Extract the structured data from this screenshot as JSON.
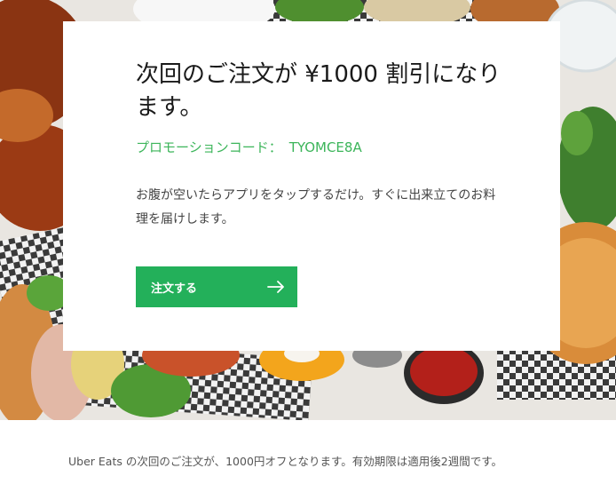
{
  "hero": {
    "title": "次回のご注文が ¥1000 割引になります。",
    "promo_label": "プロモーションコード：",
    "promo_code": "TYOMCE8A",
    "description": "お腹が空いたらアプリをタップするだけ。すぐに出来立てのお料理を届けします。",
    "cta_label": "注文する",
    "cta_icon": "arrow-right-icon"
  },
  "footer": {
    "text": "Uber Eats の次回のご注文が、1000円オフとなります。有効期限は適用後2週間です。"
  },
  "colors": {
    "accent": "#23b05a",
    "promo_text": "#3cb55a"
  }
}
